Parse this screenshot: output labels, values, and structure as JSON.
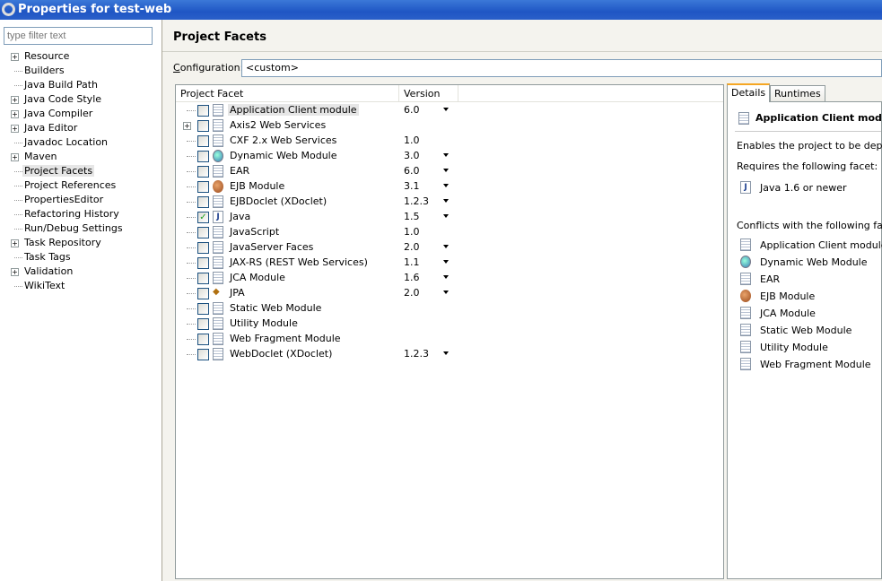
{
  "window": {
    "title": "Properties for test-web"
  },
  "sidebar": {
    "filter_placeholder": "type filter text",
    "items": [
      {
        "label": "Resource",
        "exp": true
      },
      {
        "label": "Builders"
      },
      {
        "label": "Java Build Path"
      },
      {
        "label": "Java Code Style",
        "exp": true
      },
      {
        "label": "Java Compiler",
        "exp": true
      },
      {
        "label": "Java Editor",
        "exp": true
      },
      {
        "label": "Javadoc Location"
      },
      {
        "label": "Maven",
        "exp": true
      },
      {
        "label": "Project Facets",
        "sel": true
      },
      {
        "label": "Project References"
      },
      {
        "label": "PropertiesEditor"
      },
      {
        "label": "Refactoring History"
      },
      {
        "label": "Run/Debug Settings"
      },
      {
        "label": "Task Repository",
        "exp": true
      },
      {
        "label": "Task Tags"
      },
      {
        "label": "Validation",
        "exp": true
      },
      {
        "label": "WikiText"
      }
    ]
  },
  "page": {
    "title": "Project Facets",
    "config_label": "Configuration:",
    "config_value": "<custom>"
  },
  "table": {
    "col_facet": "Project Facet",
    "col_version": "Version",
    "rows": [
      {
        "name": "Application Client module",
        "version": "6.0",
        "dd": true,
        "icon": "doc",
        "sel": true
      },
      {
        "name": "Axis2 Web Services",
        "version": "",
        "icon": "doc",
        "exp": true
      },
      {
        "name": "CXF 2.x Web Services",
        "version": "1.0",
        "icon": "doc"
      },
      {
        "name": "Dynamic Web Module",
        "version": "3.0",
        "dd": true,
        "icon": "glob"
      },
      {
        "name": "EAR",
        "version": "6.0",
        "dd": true,
        "icon": "doc"
      },
      {
        "name": "EJB Module",
        "version": "3.1",
        "dd": true,
        "icon": "bean"
      },
      {
        "name": "EJBDoclet (XDoclet)",
        "version": "1.2.3",
        "dd": true,
        "icon": "doc"
      },
      {
        "name": "Java",
        "version": "1.5",
        "dd": true,
        "icon": "jv",
        "checked": true
      },
      {
        "name": "JavaScript",
        "version": "1.0",
        "icon": "doc"
      },
      {
        "name": "JavaServer Faces",
        "version": "2.0",
        "dd": true,
        "icon": "doc"
      },
      {
        "name": "JAX-RS (REST Web Services)",
        "version": "1.1",
        "dd": true,
        "icon": "doc"
      },
      {
        "name": "JCA Module",
        "version": "1.6",
        "dd": true,
        "icon": "doc"
      },
      {
        "name": "JPA",
        "version": "2.0",
        "dd": true,
        "icon": "jpa"
      },
      {
        "name": "Static Web Module",
        "version": "",
        "icon": "doc"
      },
      {
        "name": "Utility Module",
        "version": "",
        "icon": "doc"
      },
      {
        "name": "Web Fragment Module",
        "version": "",
        "icon": "doc"
      },
      {
        "name": "WebDoclet (XDoclet)",
        "version": "1.2.3",
        "dd": true,
        "icon": "doc"
      }
    ]
  },
  "details": {
    "tab_details": "Details",
    "tab_runtimes": "Runtimes",
    "title": "Application Client module",
    "description": "Enables the project to be deployed",
    "requires_label": "Requires the following facet:",
    "requires": [
      {
        "name": "Java 1.6 or newer",
        "icon": "jv"
      }
    ],
    "conflicts_label": "Conflicts with the following facets",
    "conflicts": [
      {
        "name": "Application Client module",
        "icon": "doc"
      },
      {
        "name": "Dynamic Web Module",
        "icon": "glob"
      },
      {
        "name": "EAR",
        "icon": "doc"
      },
      {
        "name": "EJB Module",
        "icon": "bean"
      },
      {
        "name": "JCA Module",
        "icon": "doc"
      },
      {
        "name": "Static Web Module",
        "icon": "doc"
      },
      {
        "name": "Utility Module",
        "icon": "doc"
      },
      {
        "name": "Web Fragment Module",
        "icon": "doc"
      }
    ]
  }
}
